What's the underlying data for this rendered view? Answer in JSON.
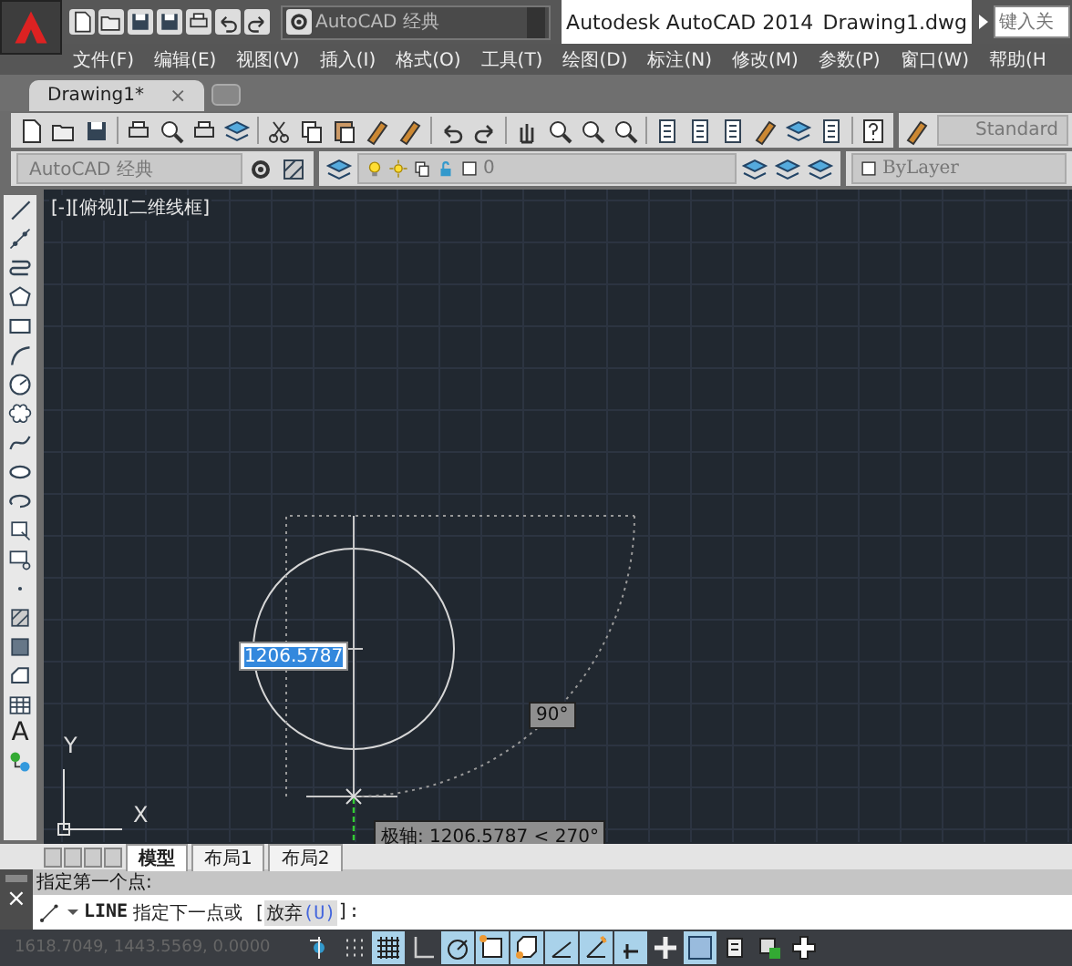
{
  "title_bar": {
    "workspace": "AutoCAD 经典",
    "app_name": "Autodesk AutoCAD 2014",
    "file_name": "Drawing1.dwg",
    "search_placeholder": "键入关"
  },
  "menu": [
    "文件(F)",
    "编辑(E)",
    "视图(V)",
    "插入(I)",
    "格式(O)",
    "工具(T)",
    "绘图(D)",
    "标注(N)",
    "修改(M)",
    "参数(P)",
    "窗口(W)",
    "帮助(H"
  ],
  "document_tabs": [
    {
      "label": "Drawing1*",
      "selected": true,
      "close": "×"
    }
  ],
  "toolbar": {
    "text_style": "Standard"
  },
  "layers_bar": {
    "workspace": "AutoCAD 经典",
    "layer": "0",
    "property": "ByLayer"
  },
  "draw_toolbar": {
    "text_tool": "A"
  },
  "viewport": {
    "label": "[-][俯视][二维线框]",
    "dynamic_input": "1206.5787",
    "angle_tip": "90°",
    "polar_tip": "极轴: 1206.5787 < 270°",
    "ucs_x": "X",
    "ucs_y": "Y"
  },
  "layout_tabs": [
    {
      "label": "模型",
      "selected": true
    },
    {
      "label": "布局1",
      "selected": false
    },
    {
      "label": "布局2",
      "selected": false
    }
  ],
  "command": {
    "close": "×",
    "history": "指定第一个点:",
    "name": "LINE",
    "prompt": "指定下一点或 [",
    "option_label": "放弃",
    "option_key": "(U)",
    "suffix": "]:"
  },
  "status_bar": {
    "coordinates": "1618.7049, 1443.5569, 0.0000",
    "toggles": [
      {
        "kind": "infer",
        "on": false
      },
      {
        "kind": "snap",
        "on": false
      },
      {
        "kind": "grid",
        "on": true
      },
      {
        "kind": "ortho",
        "on": false
      },
      {
        "kind": "polar",
        "on": true
      },
      {
        "kind": "osnap",
        "on": true
      },
      {
        "kind": "osnap3d",
        "on": true
      },
      {
        "kind": "otrack",
        "on": true
      },
      {
        "kind": "ducs",
        "on": true
      },
      {
        "kind": "dyn",
        "on": true
      },
      {
        "kind": "lineweight",
        "on": false
      },
      {
        "kind": "transparency",
        "on": true
      },
      {
        "kind": "quickprops",
        "on": false
      },
      {
        "kind": "cycling",
        "on": false
      },
      {
        "kind": "annomonitor",
        "on": false
      }
    ]
  }
}
